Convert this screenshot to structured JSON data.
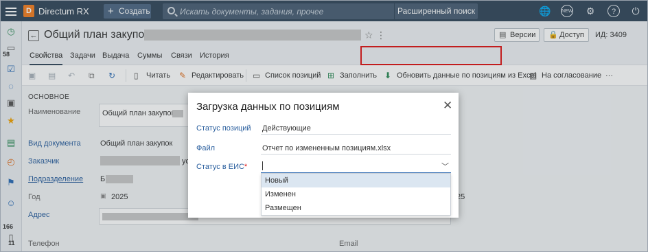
{
  "app": {
    "name": "Directum RX",
    "logo_letter": "D"
  },
  "topbar": {
    "create_label": "Создать",
    "search_placeholder": "Искать документы, задания, прочее",
    "advanced_search_label": "Расширенный поиск",
    "icons": [
      "globe-icon",
      "new-badge-icon",
      "gear-icon",
      "help-icon",
      "power-icon"
    ],
    "new_badge_text": "NEW"
  },
  "rail": {
    "badge_1": "58",
    "badge_2": "166",
    "badge_3": "11"
  },
  "document": {
    "title": "Общий план закупок",
    "versions_label": "Версии",
    "access_label": "Доступ",
    "id_text": "ИД: 3409"
  },
  "tabs": [
    {
      "label": "Свойства",
      "active": true
    },
    {
      "label": "Задачи"
    },
    {
      "label": "Выдача"
    },
    {
      "label": "Суммы"
    },
    {
      "label": "Связи"
    },
    {
      "label": "История"
    }
  ],
  "toolbar": {
    "read": "Читать",
    "edit": "Редактировать",
    "positions_list": "Список позиций",
    "fill": "Заполнить",
    "update_from_excel": "Обновить данные по позициям из Excel",
    "approval": "На согласование",
    "more": "···"
  },
  "form": {
    "section": "ОСНОВНОЕ",
    "name_label": "Наименование",
    "name_value": "Общий план закупок",
    "doc_kind_label": "Вид документа",
    "doc_kind_value": "Общий план закупок",
    "customer_label": "Заказчик",
    "customer_tail": "ус",
    "department_label": "Подразделение",
    "department_value": "Б",
    "year_label": "Год",
    "year_value": "2025",
    "year_value_2": "25",
    "address_label": "Адрес",
    "phone_label": "Телефон",
    "email_label": "Email"
  },
  "modal": {
    "title": "Загрузка данных по позициям",
    "status_label": "Статус позиций",
    "status_value": "Действующие",
    "file_label": "Файл",
    "file_value": "Отчет по измененным позициям.xlsx",
    "eis_label": "Статус в ЕИС",
    "required_mark": "*",
    "options": [
      "Новый",
      "Изменен",
      "Размещен"
    ],
    "highlighted_option": "Новый"
  },
  "colors": {
    "topbar": "#33475b",
    "accent_link": "#2a5f9e",
    "highlight_border": "#e01414",
    "logo": "#f57e20"
  }
}
